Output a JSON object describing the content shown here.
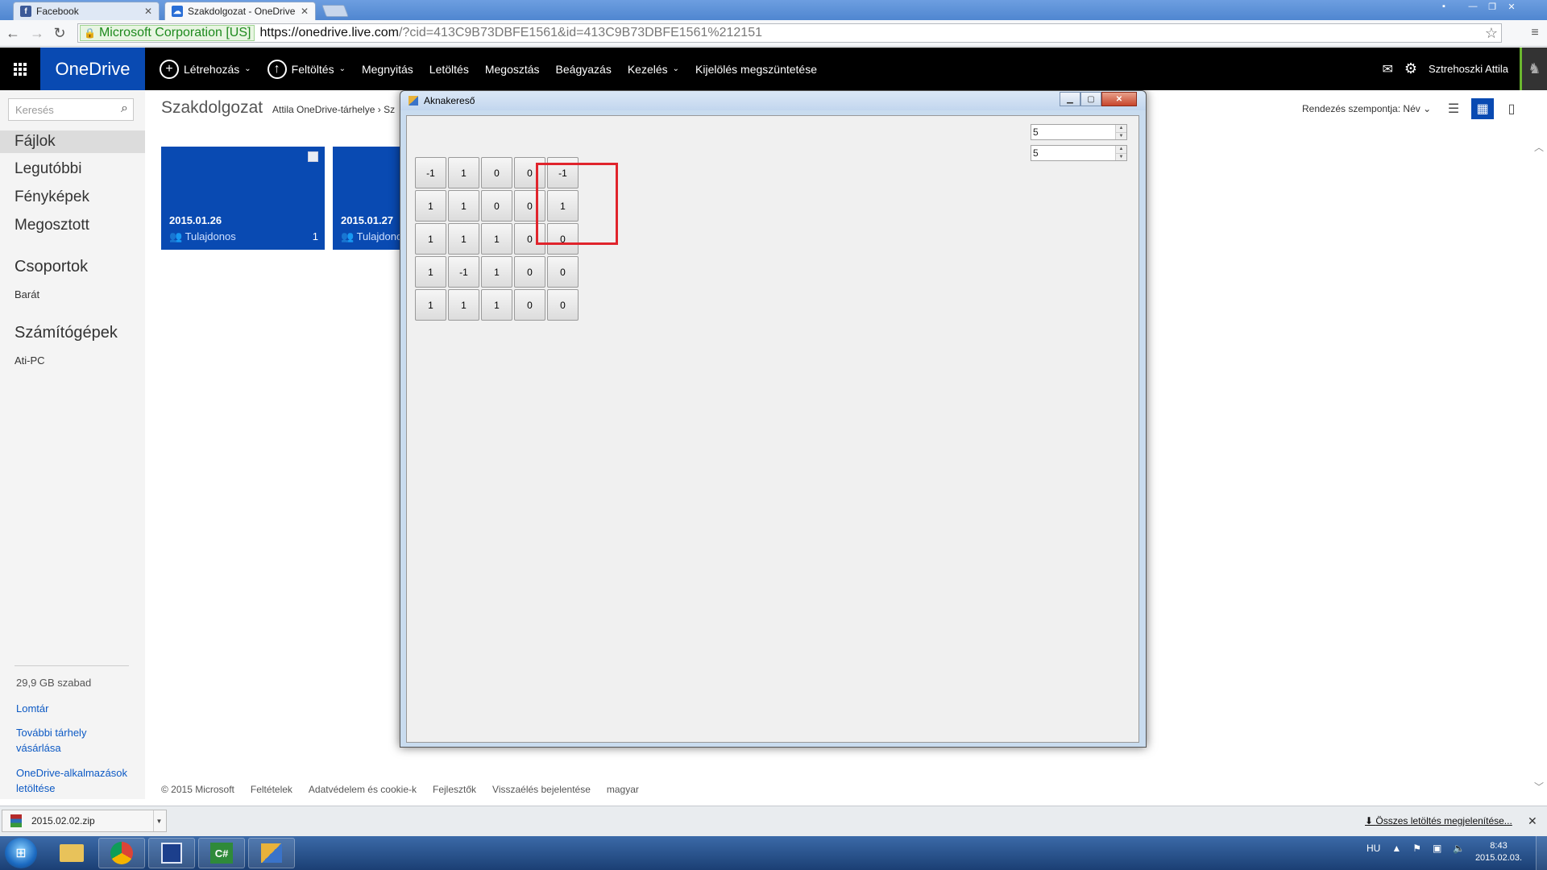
{
  "browser": {
    "tabs": [
      {
        "label": "Facebook",
        "favicon": "facebook-icon",
        "active": false
      },
      {
        "label": "Szakdolgozat - OneDrive",
        "favicon": "onedrive-cloud-icon",
        "active": true
      }
    ],
    "ev_badge": "Microsoft Corporation [US]",
    "url_host": "https://onedrive.live.com",
    "url_rest": "/?cid=413C9B73DBFE1561&id=413C9B73DBFE1561%212151"
  },
  "onedrive": {
    "brand": "OneDrive",
    "brand_color": "#094ab2",
    "commands": [
      "Létrehozás",
      "Feltöltés",
      "Megnyitás",
      "Letöltés",
      "Megosztás",
      "Beágyazás",
      "Kezelés",
      "Kijelölés megszüntetése"
    ],
    "user_name": "Sztrehoszki Attila",
    "search_placeholder": "Keresés",
    "nav": {
      "items": [
        "Fájlok",
        "Legutóbbi",
        "Fényképek",
        "Megosztott"
      ],
      "selected": "Fájlok",
      "groups_heading": "Csoportok",
      "groups": [
        "Barát"
      ],
      "pcs_heading": "Számítógépek",
      "pcs": [
        "Ati-PC"
      ],
      "quota": "29,9 GB szabad",
      "recycle": "Lomtár",
      "buy_more": "További tárhely vásárlása",
      "get_apps": "OneDrive-alkalmazások letöltése"
    },
    "folder_title": "Szakdolgozat",
    "breadcrumb": "Attila OneDrive-tárhelye",
    "breadcrumb_tail": "Sz",
    "sort_label": "Rendezés szempontja: Név",
    "tiles": [
      {
        "date": "2015.01.26",
        "owner": "Tulajdonos",
        "count": "1"
      },
      {
        "date": "2015.01.27",
        "owner": "Tulajdonos",
        "count": ""
      }
    ],
    "footer": [
      "© 2015 Microsoft",
      "Feltételek",
      "Adatvédelem és cookie-k",
      "Fejlesztők",
      "Visszaélés bejelentése",
      "magyar"
    ]
  },
  "downloads": {
    "file": "2015.02.02.zip",
    "show_all": "Összes letöltés megjelenítése..."
  },
  "taskbar": {
    "lang": "HU",
    "time": "8:43",
    "date": "2015.02.03."
  },
  "minesweeper": {
    "title": "Aknakereső",
    "rows_value": "5",
    "cols_value": "5",
    "grid": [
      [
        "-1",
        "1",
        "0",
        "0",
        "-1"
      ],
      [
        "1",
        "1",
        "0",
        "0",
        "1"
      ],
      [
        "1",
        "1",
        "1",
        "0",
        "0"
      ],
      [
        "1",
        "-1",
        "1",
        "0",
        "0"
      ],
      [
        "1",
        "1",
        "1",
        "0",
        "0"
      ]
    ],
    "highlight_color": "#e0242c"
  }
}
